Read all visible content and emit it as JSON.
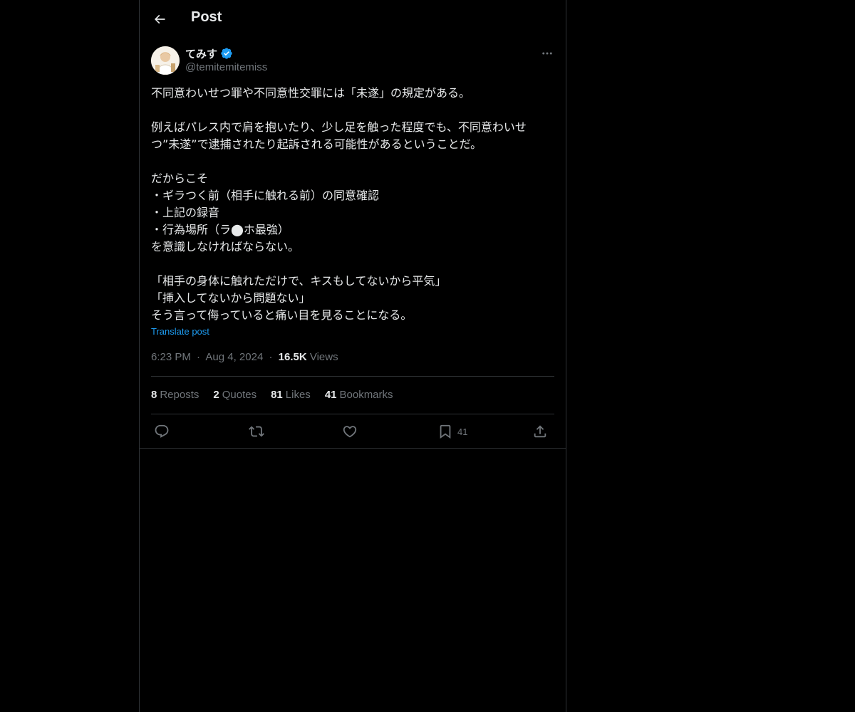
{
  "header": {
    "title": "Post",
    "back_icon": "arrow-left-icon"
  },
  "author": {
    "display_name": "てみす",
    "handle": "@temitemitemiss",
    "verified": true,
    "verified_color": "#1d9bf0"
  },
  "post": {
    "lines": [
      "不同意わいせつ罪や不同意性交罪には「未遂」の規定がある。",
      "",
      "例えばパレス内で肩を抱いたり、少し足を触った程度でも、不同意わいせ",
      "つ”未遂”で逮捕されたり起訴される可能性があるということだ。",
      "",
      "だからこそ",
      "・ギラつく前（相手に触れる前）の同意確認",
      "・上記の録音",
      "・行為場所（ラ⬤ホ最強）",
      "を意識しなければならない。",
      "",
      "「相手の身体に触れただけで、キスもしてないから平気」",
      "「挿入してないから問題ない」",
      "そう言って侮っていると痛い目を見ることになる。"
    ],
    "translate_label": "Translate post",
    "time": "6:23 PM",
    "date": "Aug 4, 2024",
    "views_count": "16.5K",
    "views_label": "Views",
    "separator": "·"
  },
  "stats": [
    {
      "num": "8",
      "label": "Reposts"
    },
    {
      "num": "2",
      "label": "Quotes"
    },
    {
      "num": "81",
      "label": "Likes"
    },
    {
      "num": "41",
      "label": "Bookmarks"
    }
  ],
  "actions": {
    "reply_icon": "reply-icon",
    "repost_icon": "repost-icon",
    "like_icon": "heart-icon",
    "bookmark_icon": "bookmark-icon",
    "bookmark_count": "41",
    "share_icon": "share-icon"
  },
  "colors": {
    "background": "#000000",
    "text": "#e7e9ea",
    "secondary": "#71767b",
    "accent": "#1d9bf0",
    "border": "#2f3336"
  }
}
